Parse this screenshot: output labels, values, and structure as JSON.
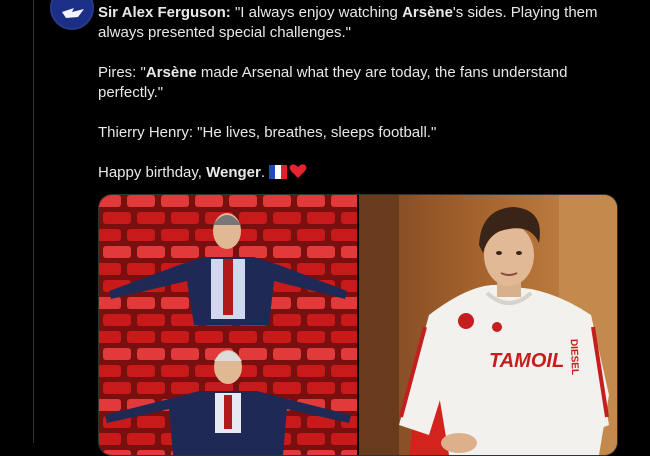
{
  "tweet": {
    "avatar_icon": "account-avatar-icon",
    "lines": [
      {
        "segments": [
          {
            "text": "Sir Alex Ferguson:",
            "bold": true
          },
          {
            "text": " \"I always enjoy watching ",
            "bold": false
          },
          {
            "text": "Arsène",
            "bold": true
          },
          {
            "text": "'s sides. Playing them always presented special challenges.\"",
            "bold": false
          }
        ]
      },
      {
        "segments": [
          {
            "text": "Pires: \"",
            "bold": false
          },
          {
            "text": "Arsène",
            "bold": true
          },
          {
            "text": " made Arsenal what they are today, the fans understand perfectly.\"",
            "bold": false
          }
        ]
      },
      {
        "segments": [
          {
            "text": "Thierry Henry: \"He lives, breathes, sleeps football.\"",
            "bold": false
          }
        ]
      },
      {
        "segments": [
          {
            "text": "Happy birthday, ",
            "bold": false
          },
          {
            "text": "Wenger",
            "bold": true
          },
          {
            "text": ". ",
            "bold": false
          }
        ]
      }
    ],
    "emojis": [
      "flag-france-icon",
      "red-heart-icon"
    ]
  },
  "media": {
    "left_photo": "red-stadium-seats-photo",
    "right_photo": "shirt-photo",
    "shirt_text_1": "TAMOIL",
    "shirt_text_2": "DIESEL"
  },
  "colors": {
    "background": "#000000",
    "text": "#e7e9ea",
    "divider": "#2f3336",
    "seat_red": "#c81a1a",
    "heart_red": "#f91880"
  }
}
